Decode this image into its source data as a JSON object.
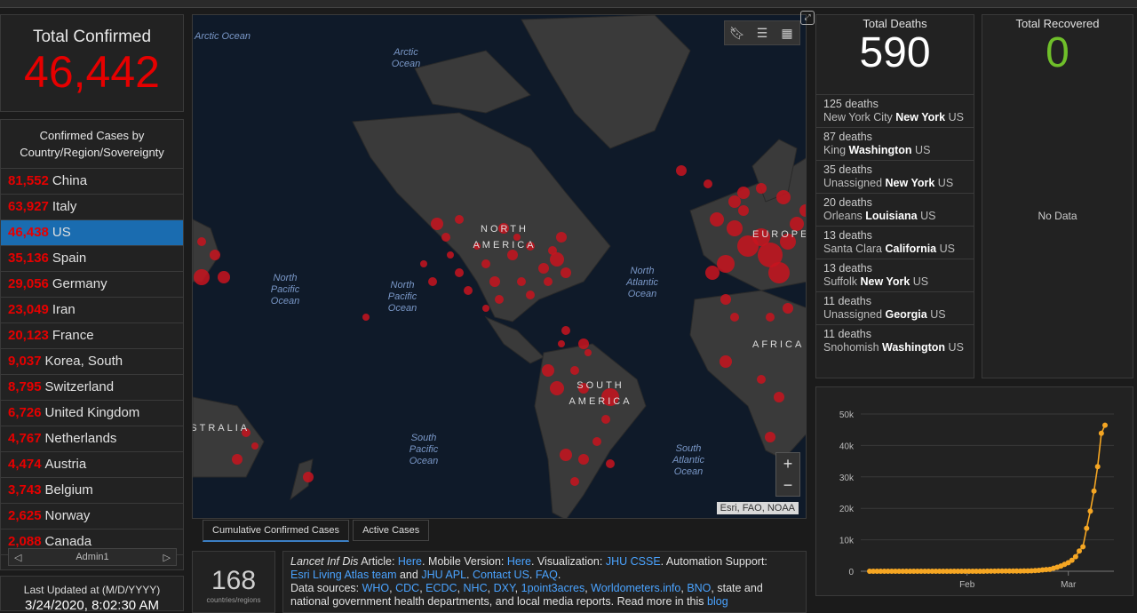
{
  "total_confirmed": {
    "title": "Total Confirmed",
    "value": "46,442"
  },
  "country_list": {
    "header": "Confirmed Cases by Country/Region/Sovereignty",
    "rows": [
      {
        "count": "81,552",
        "name": "China"
      },
      {
        "count": "63,927",
        "name": "Italy"
      },
      {
        "count": "46,438",
        "name": "US",
        "selected": true
      },
      {
        "count": "35,136",
        "name": "Spain"
      },
      {
        "count": "29,056",
        "name": "Germany"
      },
      {
        "count": "23,049",
        "name": "Iran"
      },
      {
        "count": "20,123",
        "name": "France"
      },
      {
        "count": "9,037",
        "name": "Korea, South"
      },
      {
        "count": "8,795",
        "name": "Switzerland"
      },
      {
        "count": "6,726",
        "name": "United Kingdom"
      },
      {
        "count": "4,767",
        "name": "Netherlands"
      },
      {
        "count": "4,474",
        "name": "Austria"
      },
      {
        "count": "3,743",
        "name": "Belgium"
      },
      {
        "count": "2,625",
        "name": "Norway"
      },
      {
        "count": "2,088",
        "name": "Canada"
      }
    ],
    "pager_label": "Admin1"
  },
  "last_updated": {
    "label": "Last Updated at (M/D/YYYY)",
    "value": "3/24/2020, 8:02:30 AM"
  },
  "map": {
    "labels": {
      "arctic1": "Arctic Ocean",
      "arctic2": "Arctic Ocean",
      "npac1": "North Pacific Ocean",
      "npac2": "North Pacific Ocean",
      "natl": "North Atlantic Ocean",
      "spac": "South Pacific Ocean",
      "satl": "South Atlantic Ocean",
      "namerica": "NORTH AMERICA",
      "samerica": "SOUTH AMERICA",
      "europe": "EUROPE",
      "africa": "AFRICA",
      "australia": "AUSTRALIA"
    },
    "attribution": "Esri, FAO, NOAA",
    "icons": [
      "bookmark-icon",
      "list-icon",
      "qr-icon"
    ]
  },
  "tabs": [
    "Cumulative Confirmed Cases",
    "Active Cases"
  ],
  "count_box": {
    "value": "168",
    "label": "countries/regions"
  },
  "info": {
    "line1_italic": "Lancet Inf Dis",
    "line1_a": " Article: ",
    "link_here1": "Here",
    "line1_b": ". Mobile Version: ",
    "link_here2": "Here",
    "line1_c": ". Visualization: ",
    "link_jhu": "JHU CSSE",
    "line1_d": ". Automation Support:",
    "link_esri": "Esri Living Atlas team",
    "line2_a": " and ",
    "link_apl": "JHU APL",
    "line2_b": ". ",
    "link_contact": "Contact US",
    "line2_c": ". ",
    "link_faq": "FAQ",
    "line2_d": ".",
    "line3_a": "Data sources: ",
    "sources": [
      "WHO",
      "CDC",
      "ECDC",
      "NHC",
      "DXY",
      "1point3acres",
      "Worldometers.info",
      "BNO"
    ],
    "line3_b": ", state and",
    "line4": "national government health departments, and local media reports. Read more in this ",
    "link_blog": "blog"
  },
  "total_deaths": {
    "title": "Total Deaths",
    "value": "590",
    "rows": [
      {
        "deaths": "125 deaths",
        "pre": "New York City ",
        "bold": "New York",
        "post": " US"
      },
      {
        "deaths": "87 deaths",
        "pre": "King ",
        "bold": "Washington",
        "post": " US"
      },
      {
        "deaths": "35 deaths",
        "pre": "Unassigned ",
        "bold": "New York",
        "post": " US"
      },
      {
        "deaths": "20 deaths",
        "pre": "Orleans ",
        "bold": "Louisiana",
        "post": " US"
      },
      {
        "deaths": "13 deaths",
        "pre": "Santa Clara ",
        "bold": "California",
        "post": " US"
      },
      {
        "deaths": "13 deaths",
        "pre": "Suffolk ",
        "bold": "New York",
        "post": " US"
      },
      {
        "deaths": "11 deaths",
        "pre": "Unassigned ",
        "bold": "Georgia",
        "post": " US"
      },
      {
        "deaths": "11 deaths",
        "pre": "Snohomish ",
        "bold": "Washington",
        "post": " US"
      }
    ]
  },
  "total_recovered": {
    "title": "Total Recovered",
    "value": "0",
    "no_data": "No Data"
  },
  "chart_data": {
    "type": "line",
    "x_tick_labels": [
      "Feb",
      "Mar"
    ],
    "y_tick_labels": [
      "0",
      "10k",
      "20k",
      "30k",
      "40k",
      "50k"
    ],
    "ylim": [
      0,
      50000
    ],
    "color": "#f5a623",
    "values": [
      1,
      1,
      2,
      2,
      5,
      5,
      5,
      5,
      5,
      7,
      8,
      8,
      11,
      11,
      11,
      11,
      12,
      12,
      12,
      12,
      12,
      13,
      13,
      14,
      14,
      15,
      15,
      15,
      15,
      15,
      15,
      15,
      35,
      35,
      35,
      53,
      53,
      59,
      60,
      62,
      70,
      76,
      101,
      122,
      153,
      221,
      278,
      417,
      537,
      605,
      959,
      1281,
      1663,
      2179,
      2727,
      3499,
      4632,
      6421,
      7786,
      13680,
      19101,
      25493,
      33276,
      43847,
      46442
    ]
  }
}
